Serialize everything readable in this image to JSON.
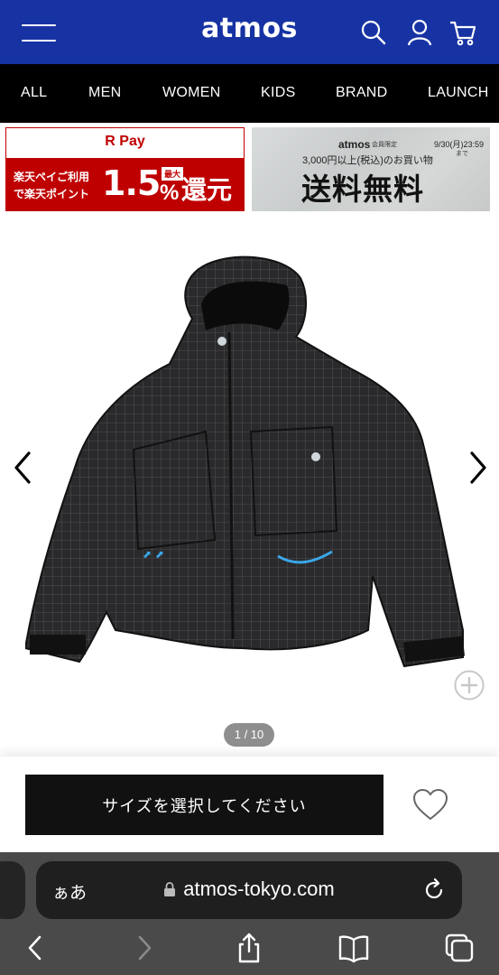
{
  "header": {
    "logo": "atmos",
    "bg_color": "#1733a3"
  },
  "nav": {
    "items": [
      "ALL",
      "MEN",
      "WOMEN",
      "KIDS",
      "BRAND",
      "LAUNCH"
    ]
  },
  "banners": {
    "rpay": {
      "title": "R Pay",
      "line1": "楽天ペイご利用",
      "line2": "で楽天ポイント",
      "rate": "1.5",
      "badge": "最大",
      "percent": "%",
      "reward": "還元",
      "color": "#bf0000"
    },
    "shipping": {
      "brand": "atmos",
      "member": "会員限定",
      "date": "9/30(月)23:59",
      "until": "まで",
      "condition": "3,000円以上(税込)のお買い物",
      "headline": "送料無料"
    }
  },
  "product": {
    "image_icon": "product-jacket-photo",
    "pager": "1 / 10"
  },
  "action": {
    "size_button_label": "サイズを選択してください",
    "favorite_icon": "heart-icon"
  },
  "browser": {
    "aa_label": "ぁあ",
    "url": "atmos-tokyo.com"
  }
}
